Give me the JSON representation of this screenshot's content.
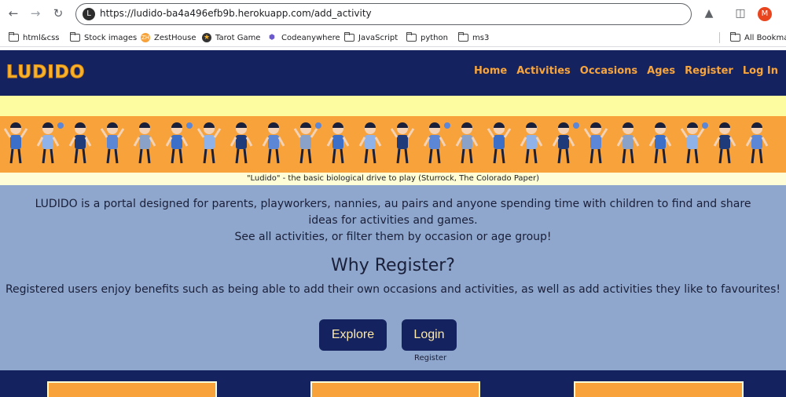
{
  "browser": {
    "url": "https://ludido-ba4a496efb9b.herokuapp.com/add_activity",
    "profile_initial": "M",
    "bookmarks": [
      {
        "label": "html&css",
        "icon": "folder-icon"
      },
      {
        "label": "Stock images",
        "icon": "folder-icon"
      },
      {
        "label": "ZestHouse",
        "icon": "zesthouse-icon"
      },
      {
        "label": "Tarot Game",
        "icon": "tarot-icon"
      },
      {
        "label": "Codeanywhere",
        "icon": "codeanywhere-icon"
      },
      {
        "label": "JavaScript",
        "icon": "folder-icon"
      },
      {
        "label": "python",
        "icon": "folder-icon"
      },
      {
        "label": "ms3",
        "icon": "folder-icon"
      }
    ],
    "all_bookmarks_label": "All Bookmar"
  },
  "site": {
    "logo": "LUDIDO",
    "nav": [
      "Home",
      "Activities",
      "Occasions",
      "Ages",
      "Register",
      "Log In"
    ],
    "banner_caption": "\"Ludido\" - the basic biological drive to play (Sturrock, The Colorado Paper)",
    "intro_line1": "LUDIDO is a portal designed for parents, playworkers, nannies, au pairs and anyone spending time with children to find and share ideas for activities and games.",
    "intro_line2": "See all activities, or filter them by occasion or age group!",
    "why_title": "Why Register?",
    "benefits": "Registered users enjoy benefits such as being able to add their own occasions and activities, as well as add activities they like to favourites!",
    "explore_label": "Explore",
    "login_label": "Login",
    "register_label": "Register"
  },
  "colors": {
    "header_bg": "#152260",
    "accent_orange": "#f7a23a",
    "main_bg": "#8fa7cc",
    "strip_yellow": "#fdfca0"
  }
}
